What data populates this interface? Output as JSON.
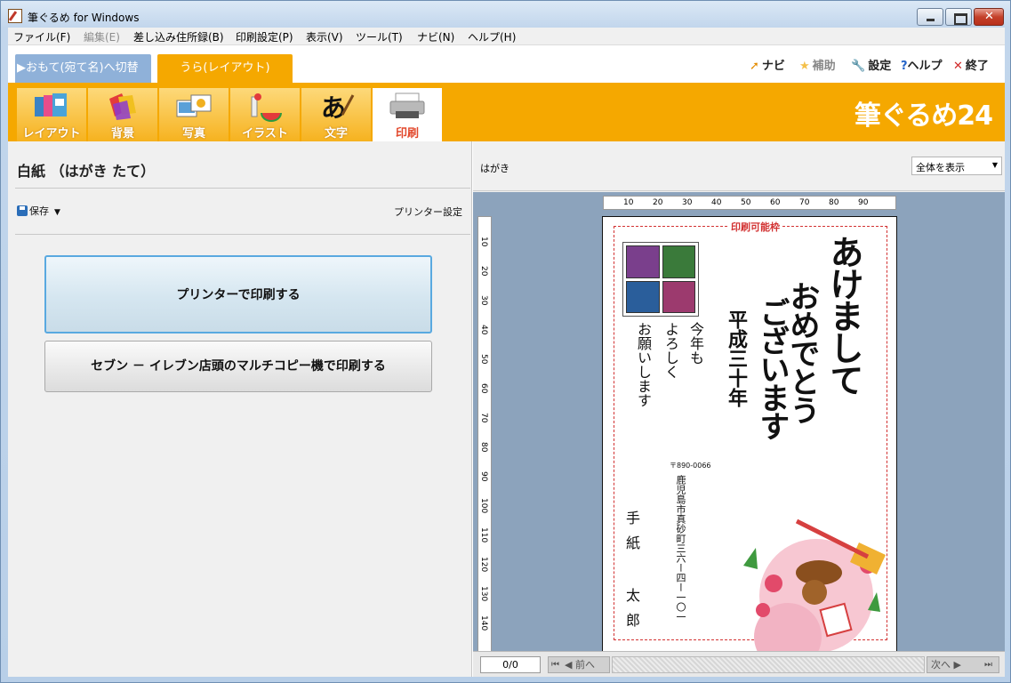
{
  "window": {
    "title": "筆ぐるめ for Windows"
  },
  "menu": [
    {
      "label": "ファイル(F)",
      "disabled": false
    },
    {
      "label": "編集(E)",
      "disabled": true
    },
    {
      "label": "差し込み住所録(B)",
      "disabled": false
    },
    {
      "label": "印刷設定(P)",
      "disabled": false
    },
    {
      "label": "表示(V)",
      "disabled": false
    },
    {
      "label": "ツール(T)",
      "disabled": false
    },
    {
      "label": "ナビ(N)",
      "disabled": false
    },
    {
      "label": "ヘルプ(H)",
      "disabled": false
    }
  ],
  "tabs": {
    "omote": "▶おもて(宛て名)へ切替",
    "ura": "うら(レイアウト)"
  },
  "topnav": {
    "navi": "ナビ",
    "hojo": "補助",
    "settei": "設定",
    "help": "ヘルプ",
    "exit": "終了"
  },
  "toolbar": {
    "items": [
      {
        "label": "レイアウト",
        "icon": "layout-icon"
      },
      {
        "label": "背景",
        "icon": "background-icon"
      },
      {
        "label": "写真",
        "icon": "photo-icon"
      },
      {
        "label": "イラスト",
        "icon": "illustration-icon"
      },
      {
        "label": "文字",
        "icon": "text-icon"
      },
      {
        "label": "印刷",
        "icon": "printer-icon"
      }
    ],
    "active": 5,
    "brand": "筆ぐるめ24"
  },
  "left": {
    "title": "白紙 （はがき たて）",
    "save": "保存",
    "printer_settings": "プリンター設定",
    "print_button": "プリンターで印刷する",
    "seven_button": "セブン － イレブン店頭のマルチコピー機で印刷する"
  },
  "right": {
    "paper": "はがき",
    "zoom": "全体を表示",
    "ruler_h": [
      "10",
      "20",
      "30",
      "40",
      "50",
      "60",
      "70",
      "80",
      "90"
    ],
    "ruler_v": [
      "10",
      "20",
      "30",
      "40",
      "50",
      "60",
      "70",
      "80",
      "90",
      "100",
      "110",
      "120",
      "130",
      "140"
    ],
    "card": {
      "printable_label": "印刷可能枠",
      "greeting_1": "あけまして",
      "greeting_2": "おめでとう",
      "greeting_3": "ございます",
      "era": "平成三十年",
      "msg_1": "今年も",
      "msg_2": "よろしく",
      "msg_3": "お願いします",
      "postal": "〒890-0066",
      "address": "鹿児島市真砂町三六ー四ー一〇一",
      "sender": "手紙 太郎"
    },
    "footer": {
      "page": "0/0",
      "prev": "前へ",
      "next": "次へ"
    }
  }
}
